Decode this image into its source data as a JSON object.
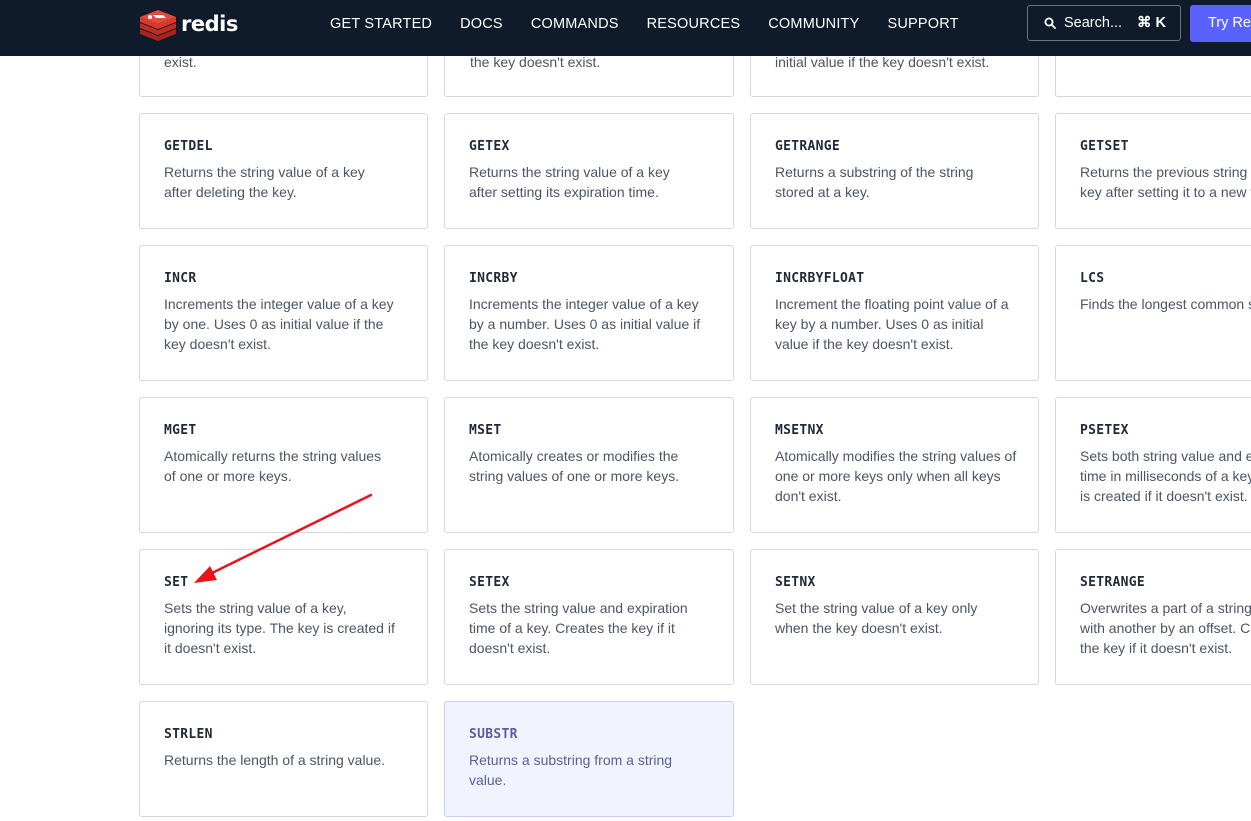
{
  "header": {
    "brand": "redis",
    "nav": [
      "GET STARTED",
      "DOCS",
      "COMMANDS",
      "RESOURCES",
      "COMMUNITY",
      "SUPPORT"
    ],
    "search_label": "Search...",
    "search_shortcut": "⌘ K",
    "try_label": "Try Redis"
  },
  "top_row_fragments": [
    "exist.",
    "the key doesn't exist.",
    "initial value if the key doesn't exist.",
    ""
  ],
  "commands": [
    {
      "name": "GETDEL",
      "desc": "Returns the string value of a key after deleting the key."
    },
    {
      "name": "GETEX",
      "desc": "Returns the string value of a key after setting its expiration time."
    },
    {
      "name": "GETRANGE",
      "desc": "Returns a substring of the string stored at a key."
    },
    {
      "name": "GETSET",
      "desc": "Returns the previous string value of a key after setting it to a new value."
    },
    {
      "name": "INCR",
      "desc": "Increments the integer value of a key by one. Uses 0 as initial value if the key doesn't exist."
    },
    {
      "name": "INCRBY",
      "desc": "Increments the integer value of a key by a number. Uses 0 as initial value if the key doesn't exist."
    },
    {
      "name": "INCRBYFLOAT",
      "desc": "Increment the floating point value of a key by a number. Uses 0 as initial value if the key doesn't exist."
    },
    {
      "name": "LCS",
      "desc": "Finds the longest common substring."
    },
    {
      "name": "MGET",
      "desc": "Atomically returns the string values of one or more keys."
    },
    {
      "name": "MSET",
      "desc": "Atomically creates or modifies the string values of one or more keys."
    },
    {
      "name": "MSETNX",
      "desc": "Atomically modifies the string values of one or more keys only when all keys don't exist."
    },
    {
      "name": "PSETEX",
      "desc": "Sets both string value and expiration time in milliseconds of a key. The key is created if it doesn't exist."
    },
    {
      "name": "SET",
      "desc": "Sets the string value of a key, ignoring its type. The key is created if it doesn't exist."
    },
    {
      "name": "SETEX",
      "desc": "Sets the string value and expiration time of a key. Creates the key if it doesn't exist."
    },
    {
      "name": "SETNX",
      "desc": "Set the string value of a key only when the key doesn't exist."
    },
    {
      "name": "SETRANGE",
      "desc": "Overwrites a part of a string value with another by an offset. Creates the key if it doesn't exist."
    },
    {
      "name": "STRLEN",
      "desc": "Returns the length of a string value."
    },
    {
      "name": "SUBSTR",
      "desc": "Returns a substring from a string value.",
      "highlighted": true
    }
  ],
  "colors": {
    "header_bg": "#0f1a2a",
    "accent": "#5961ff",
    "brand_red": "#dc382c",
    "annotation_arrow": "#e8141c"
  }
}
